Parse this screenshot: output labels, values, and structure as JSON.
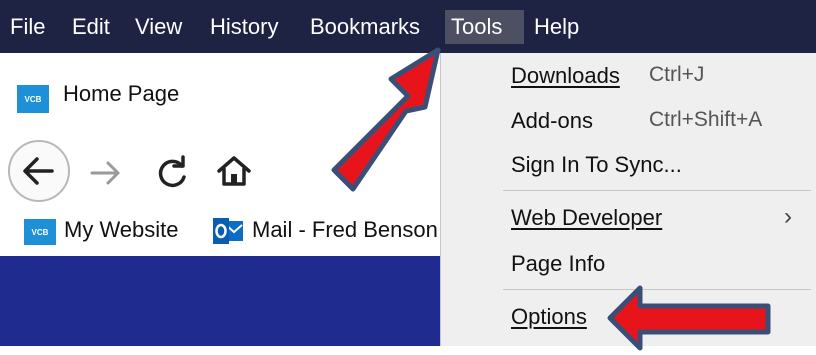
{
  "menubar": {
    "items": [
      {
        "label": "File"
      },
      {
        "label": "Edit"
      },
      {
        "label": "View"
      },
      {
        "label": "History"
      },
      {
        "label": "Bookmarks"
      },
      {
        "label": "Tools"
      },
      {
        "label": "Help"
      }
    ]
  },
  "tab": {
    "icon_text": "VCB",
    "title": "Home Page",
    "close": "✕"
  },
  "bookmarks": [
    {
      "icon_text": "VCB",
      "label": "My Website"
    },
    {
      "icon": "outlook-icon",
      "label": "Mail - Fred Benson"
    }
  ],
  "tools_menu": {
    "items": [
      {
        "label": "Downloads",
        "shortcut": "Ctrl+J"
      },
      {
        "label": "Add-ons",
        "shortcut": "Ctrl+Shift+A"
      },
      {
        "label": "Sign In To Sync..."
      },
      {
        "label": "Web Developer",
        "submenu": "›"
      },
      {
        "label": "Page Info"
      },
      {
        "label": "Options"
      }
    ]
  },
  "colors": {
    "menubar_bg": "#1f2343",
    "active_menu_bg": "#4d5063",
    "dropdown_bg": "#efefef",
    "content_band": "#1f2b8e",
    "annotation_arrow": "#e8141b",
    "annotation_outline": "#3a4f78",
    "vcb_icon": "#1e90d8"
  }
}
